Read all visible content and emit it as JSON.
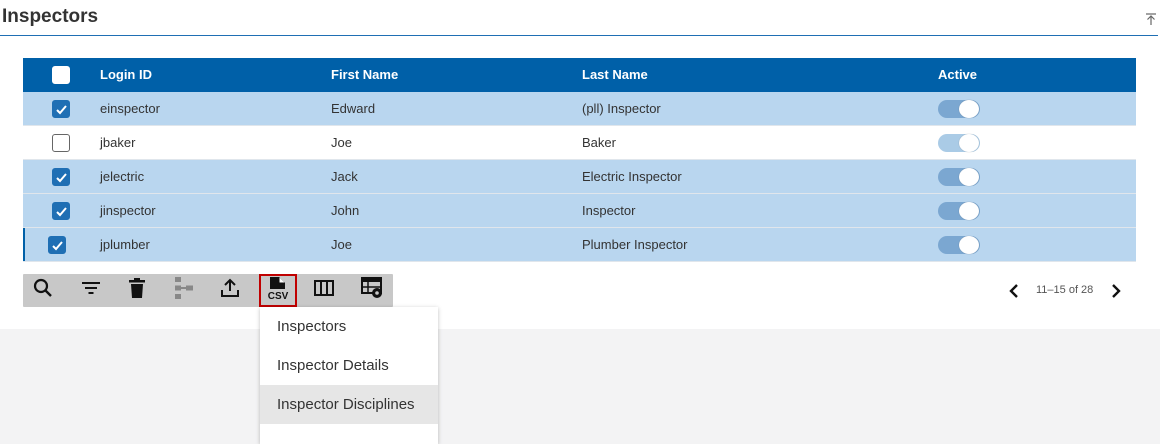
{
  "panel": {
    "title": "Inspectors"
  },
  "grid": {
    "columns": {
      "login": "Login ID",
      "first": "First Name",
      "last": "Last Name",
      "active": "Active"
    },
    "rows": [
      {
        "login": "einspector",
        "first": "Edward",
        "last": "(pll) Inspector",
        "selected": true,
        "active": true
      },
      {
        "login": "jbaker",
        "first": "Joe",
        "last": "Baker",
        "selected": false,
        "active": true
      },
      {
        "login": "jelectric",
        "first": "Jack",
        "last": "Electric Inspector",
        "selected": true,
        "active": true
      },
      {
        "login": "jinspector",
        "first": "John",
        "last": "Inspector",
        "selected": true,
        "active": true
      },
      {
        "login": "jplumber",
        "first": "Joe",
        "last": "Plumber Inspector",
        "selected": true,
        "active": true
      }
    ]
  },
  "toolbar": {
    "icons": [
      "search-icon",
      "filter-icon",
      "delete-icon",
      "hierarchy-icon",
      "upload-icon",
      "csv-export-icon",
      "columns-icon",
      "grid-settings-icon"
    ],
    "csv_label": "CSV"
  },
  "pager": {
    "range": "11–15 of 28"
  },
  "csv_menu": {
    "items": [
      "Inspectors",
      "Inspector Details",
      "Inspector Disciplines"
    ]
  },
  "colors": {
    "header": "#0060a8",
    "selected_row": "#b9d6ef",
    "accent": "#1f6fb4",
    "highlight_border": "#c00000"
  }
}
